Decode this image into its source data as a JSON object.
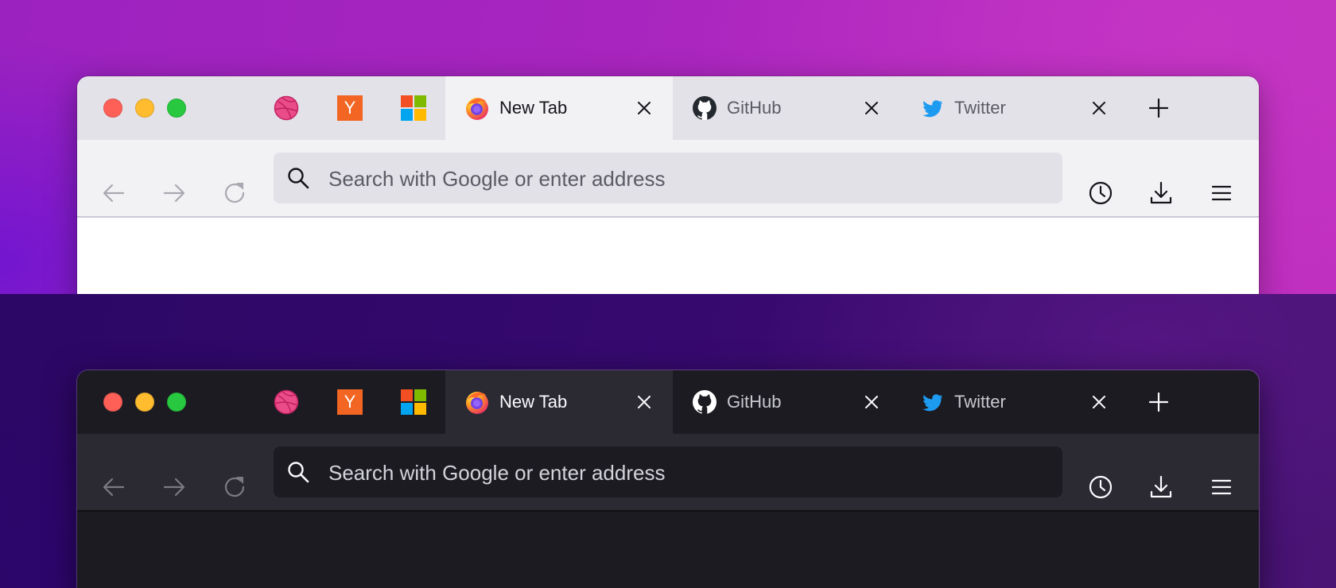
{
  "theme_colors": {
    "light_tabbar": "#e3e2e8",
    "light_toolbar": "#f2f2f5",
    "light_urlbar": "#e2e1e7",
    "dark_tabbar": "#1c1b22",
    "dark_toolbar": "#2b2a33",
    "dark_urlbar": "#1c1b22",
    "close_button": "#fe5f57",
    "minimize_button": "#febc2e",
    "zoom_button": "#28c840",
    "twitter_blue": "#1d9bf0",
    "dribbble_pink": "#ea4c89",
    "yc_orange": "#f26522"
  },
  "windows": [
    {
      "theme": "light",
      "pinned_tabs": [
        {
          "icon": "dribbble-icon"
        },
        {
          "icon": "hacker-news-icon",
          "text": "Y"
        },
        {
          "icon": "microsoft-icon"
        }
      ],
      "tabs": [
        {
          "label": "New Tab",
          "icon": "firefox-icon",
          "active": true
        },
        {
          "label": "GitHub",
          "icon": "github-icon",
          "active": false
        },
        {
          "label": "Twitter",
          "icon": "twitter-icon",
          "active": false
        }
      ],
      "url_placeholder": "Search with Google or enter address"
    },
    {
      "theme": "dark",
      "pinned_tabs": [
        {
          "icon": "dribbble-icon"
        },
        {
          "icon": "hacker-news-icon",
          "text": "Y"
        },
        {
          "icon": "microsoft-icon"
        }
      ],
      "tabs": [
        {
          "label": "New Tab",
          "icon": "firefox-icon",
          "active": true
        },
        {
          "label": "GitHub",
          "icon": "github-icon",
          "active": false
        },
        {
          "label": "Twitter",
          "icon": "twitter-icon",
          "active": false
        }
      ],
      "url_placeholder": "Search with Google or enter address"
    }
  ]
}
